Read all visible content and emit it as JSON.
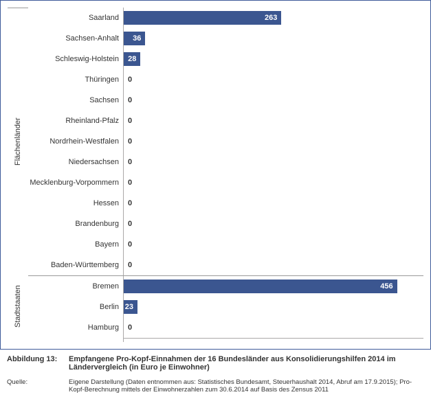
{
  "chart_data": {
    "type": "bar",
    "orientation": "horizontal",
    "title": "Empfangene Pro-Kopf-Einnahmen der 16 Bundesländer aus Konsolidierungshilfen 2014 im Ländervergleich (in Euro je Einwohner)",
    "xlabel": "",
    "ylabel": "",
    "xlim": [
      0,
      500
    ],
    "groups": [
      {
        "name": "Flächenländer",
        "items": [
          {
            "label": "Saarland",
            "value": 263
          },
          {
            "label": "Sachsen-Anhalt",
            "value": 36
          },
          {
            "label": "Schleswig-Holstein",
            "value": 28
          },
          {
            "label": "Thüringen",
            "value": 0
          },
          {
            "label": "Sachsen",
            "value": 0
          },
          {
            "label": "Rheinland-Pfalz",
            "value": 0
          },
          {
            "label": "Nordrhein-Westfalen",
            "value": 0
          },
          {
            "label": "Niedersachsen",
            "value": 0
          },
          {
            "label": "Mecklenburg-Vorpommern",
            "value": 0
          },
          {
            "label": "Hessen",
            "value": 0
          },
          {
            "label": "Brandenburg",
            "value": 0
          },
          {
            "label": "Bayern",
            "value": 0
          },
          {
            "label": "Baden-Württemberg",
            "value": 0
          }
        ]
      },
      {
        "name": "Stadtstaaten",
        "items": [
          {
            "label": "Bremen",
            "value": 456
          },
          {
            "label": "Berlin",
            "value": 23
          },
          {
            "label": "Hamburg",
            "value": 0
          }
        ]
      }
    ]
  },
  "caption": {
    "lead": "Abbildung 13:",
    "text": "Empfangene Pro-Kopf-Einnahmen der 16 Bundesländer aus Konsolidierungshilfen 2014 im Ländervergleich (in Euro je Einwohner)"
  },
  "source": {
    "lead": "Quelle:",
    "text": "Eigene Darstellung (Daten entnommen aus: Statistisches Bundesamt, Steuerhaushalt 2014, Abruf am 17.9.2015); Pro-Kopf-Berechnung mittels der Einwohnerzahlen zum 30.6.2014 auf Basis des Zensus 2011"
  },
  "colors": {
    "bar": "#3b5690",
    "border": "#3d5a99"
  }
}
